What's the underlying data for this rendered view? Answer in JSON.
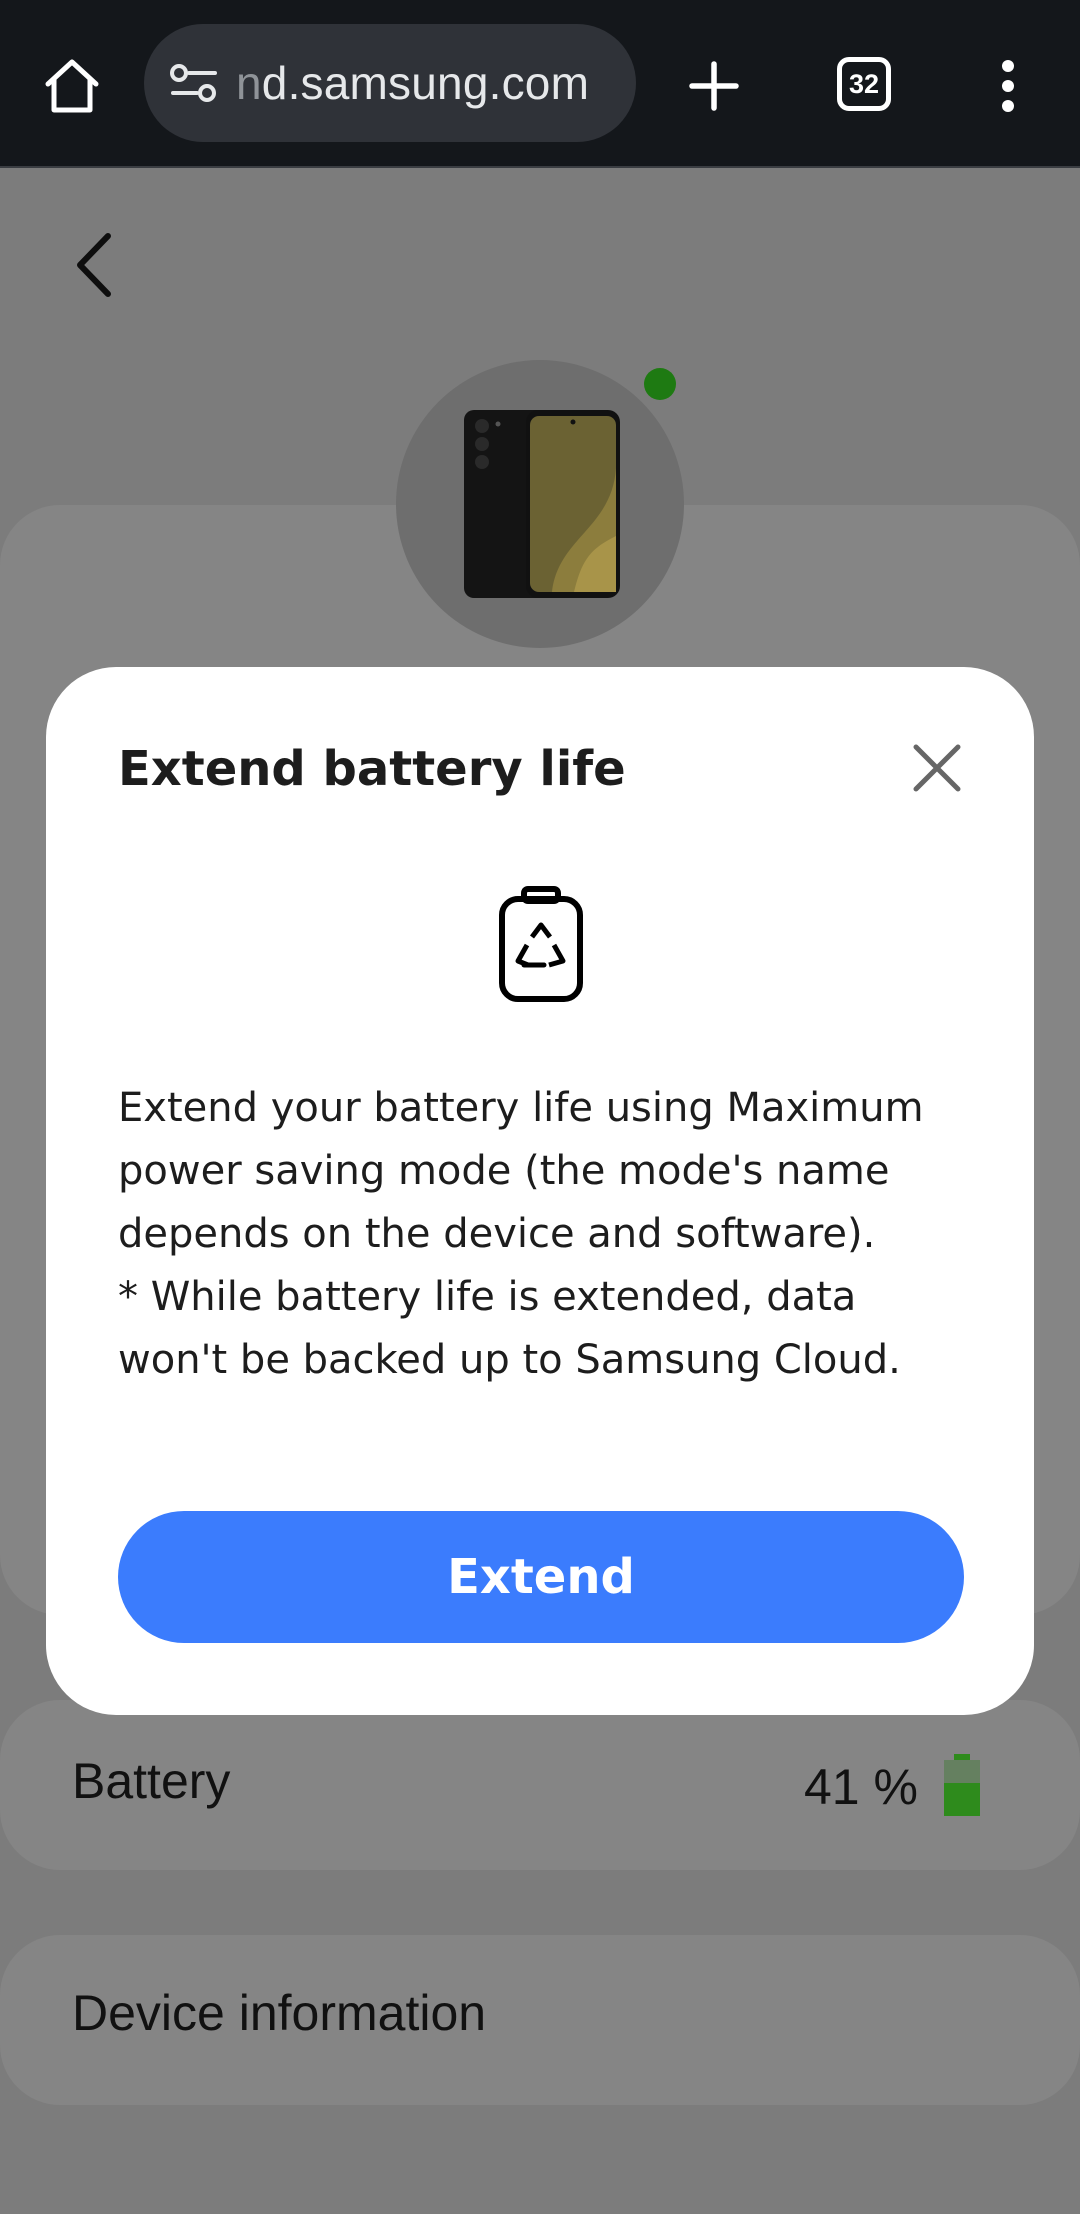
{
  "browser": {
    "url_faded": "n",
    "url_main": "d.samsung.com",
    "tab_count": "32"
  },
  "page": {
    "battery_label": "Battery",
    "battery_value": "41 %",
    "battery_level": 0.41,
    "device_info_label": "Device information",
    "online_status_color": "#1e7a12"
  },
  "modal": {
    "title": "Extend battery life",
    "body_line1": "Extend your battery life using Maximum power saving mode (the mode's name depends on the device and software).",
    "body_line2": "* While battery life is extended, data won't be backed up to Samsung Cloud.",
    "button_label": "Extend"
  },
  "colors": {
    "accent": "#3b7cfd",
    "toolbar": "#14171b",
    "battery": "#2e8b1c"
  },
  "icons": [
    "home-icon",
    "site-settings-icon",
    "plus-icon",
    "tabs-icon",
    "more-vert-icon",
    "back-arrow-icon",
    "close-icon",
    "battery-recycle-icon",
    "battery-level-icon"
  ]
}
